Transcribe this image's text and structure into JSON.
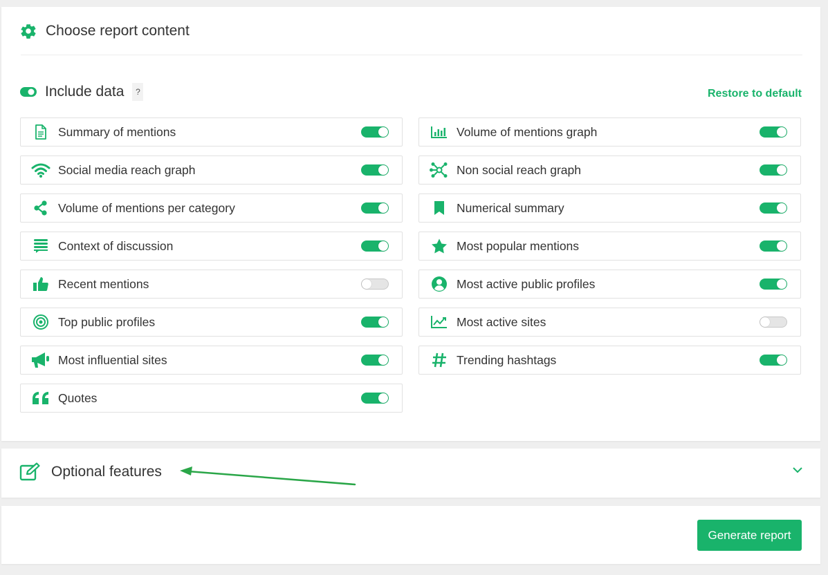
{
  "section": {
    "title": "Choose report content",
    "include_data": "Include data",
    "help": "?",
    "restore": "Restore to default"
  },
  "accent": "#19b36b",
  "items": [
    {
      "label": "Summary of mentions",
      "icon": "document-icon",
      "enabled": true
    },
    {
      "label": "Volume of mentions graph",
      "icon": "bar-chart-icon",
      "enabled": true
    },
    {
      "label": "Social media reach graph",
      "icon": "wifi-icon",
      "enabled": true
    },
    {
      "label": "Non social reach graph",
      "icon": "network-icon",
      "enabled": true
    },
    {
      "label": "Volume of mentions per category",
      "icon": "share-icon",
      "enabled": true
    },
    {
      "label": "Numerical summary",
      "icon": "bookmark-icon",
      "enabled": true
    },
    {
      "label": "Context of discussion",
      "icon": "list-icon",
      "enabled": true
    },
    {
      "label": "Most popular mentions",
      "icon": "star-icon",
      "enabled": true
    },
    {
      "label": "Recent mentions",
      "icon": "thumbs-up-icon",
      "enabled": false
    },
    {
      "label": "Most active public profiles",
      "icon": "user-circle-icon",
      "enabled": true
    },
    {
      "label": "Top public profiles",
      "icon": "target-icon",
      "enabled": true
    },
    {
      "label": "Most active sites",
      "icon": "line-chart-icon",
      "enabled": false
    },
    {
      "label": "Most influential sites",
      "icon": "megaphone-icon",
      "enabled": true
    },
    {
      "label": "Trending hashtags",
      "icon": "hashtag-icon",
      "enabled": true
    },
    {
      "label": "Quotes",
      "icon": "quote-icon",
      "enabled": true
    }
  ],
  "optional": {
    "title": "Optional features"
  },
  "generate": {
    "label": "Generate report"
  }
}
